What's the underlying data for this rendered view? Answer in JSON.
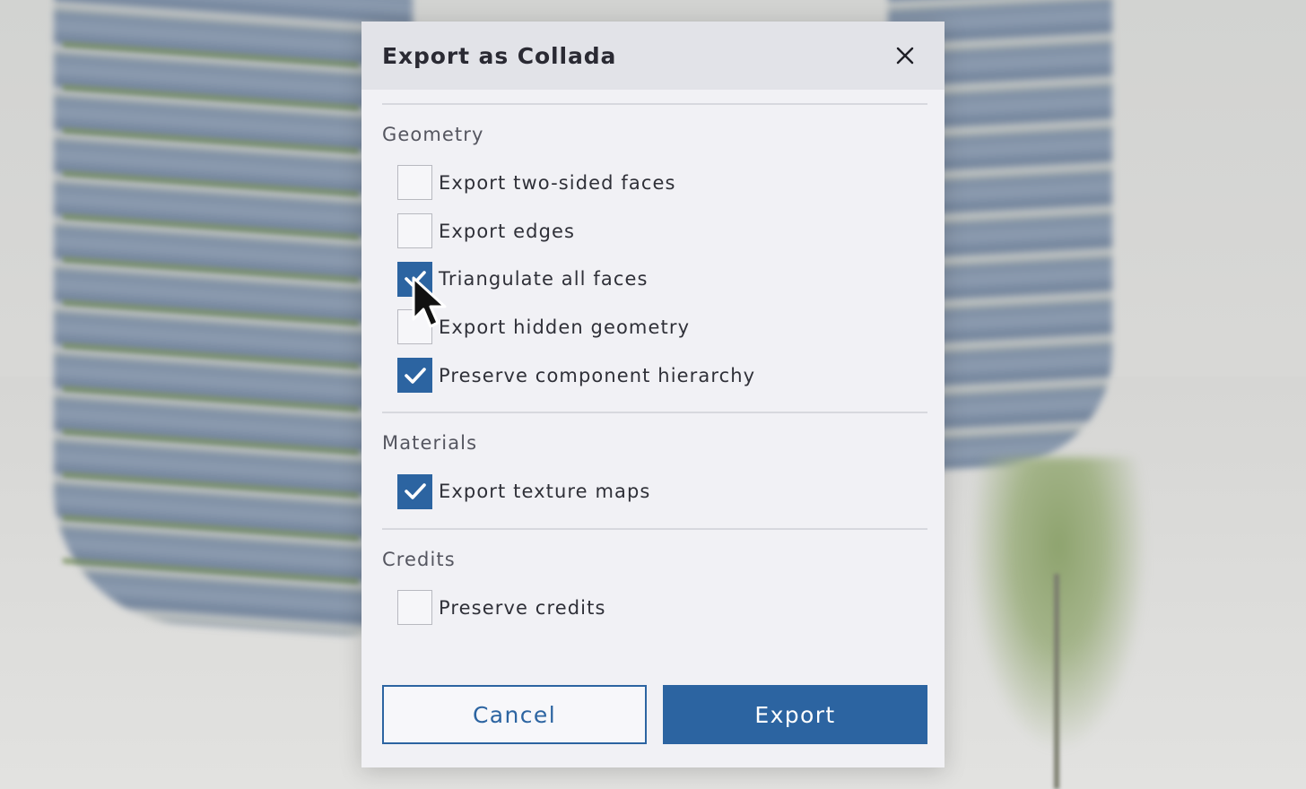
{
  "dialog": {
    "title": "Export as Collada",
    "close_icon": "close-icon"
  },
  "sections": {
    "geometry": {
      "title": "Geometry",
      "options": [
        {
          "label": "Export two-sided faces",
          "checked": false
        },
        {
          "label": "Export edges",
          "checked": false
        },
        {
          "label": "Triangulate all faces",
          "checked": true
        },
        {
          "label": "Export hidden geometry",
          "checked": false
        },
        {
          "label": "Preserve component hierarchy",
          "checked": true
        }
      ]
    },
    "materials": {
      "title": "Materials",
      "options": [
        {
          "label": "Export texture maps",
          "checked": true
        }
      ]
    },
    "credits": {
      "title": "Credits",
      "options": [
        {
          "label": "Preserve credits",
          "checked": false
        }
      ]
    }
  },
  "footer": {
    "cancel_label": "Cancel",
    "export_label": "Export"
  },
  "colors": {
    "accent": "#2c64a1",
    "dialog_bg": "#f1f1f5",
    "header_bg": "#e2e3e8"
  },
  "icons": {
    "check": "check-icon",
    "cursor": "mouse-pointer-icon"
  }
}
